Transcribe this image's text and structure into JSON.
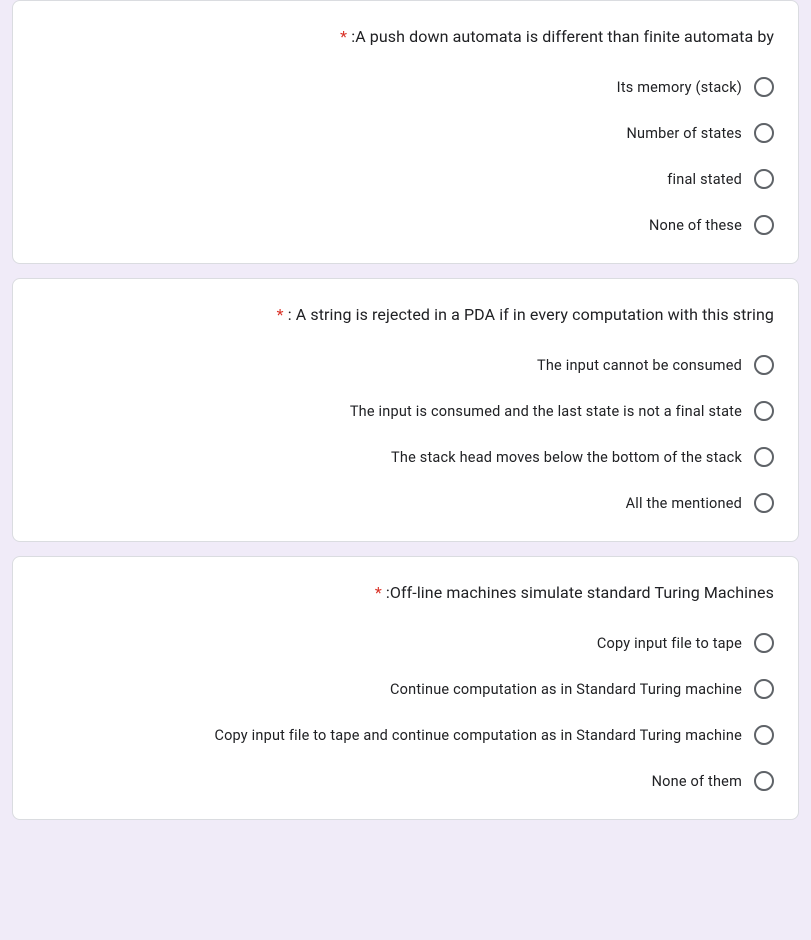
{
  "required_marker": "*",
  "questions": [
    {
      "title": ":A push down automata is different than finite automata by",
      "options": [
        "Its memory (stack)",
        "Number of states",
        "final stated",
        "None of these"
      ]
    },
    {
      "title": ": A string is rejected in a PDA if in every computation with this string",
      "options": [
        "The input cannot be consumed",
        "The input is consumed and the last state is not a final state",
        "The stack head moves below the bottom of the stack",
        "All the mentioned"
      ]
    },
    {
      "title": ":Off-line machines simulate standard Turing Machines",
      "options": [
        "Copy input file to tape",
        "Continue computation as in Standard Turing machine",
        "Copy input file to tape and continue computation as in Standard Turing machine",
        "None of them"
      ]
    }
  ]
}
